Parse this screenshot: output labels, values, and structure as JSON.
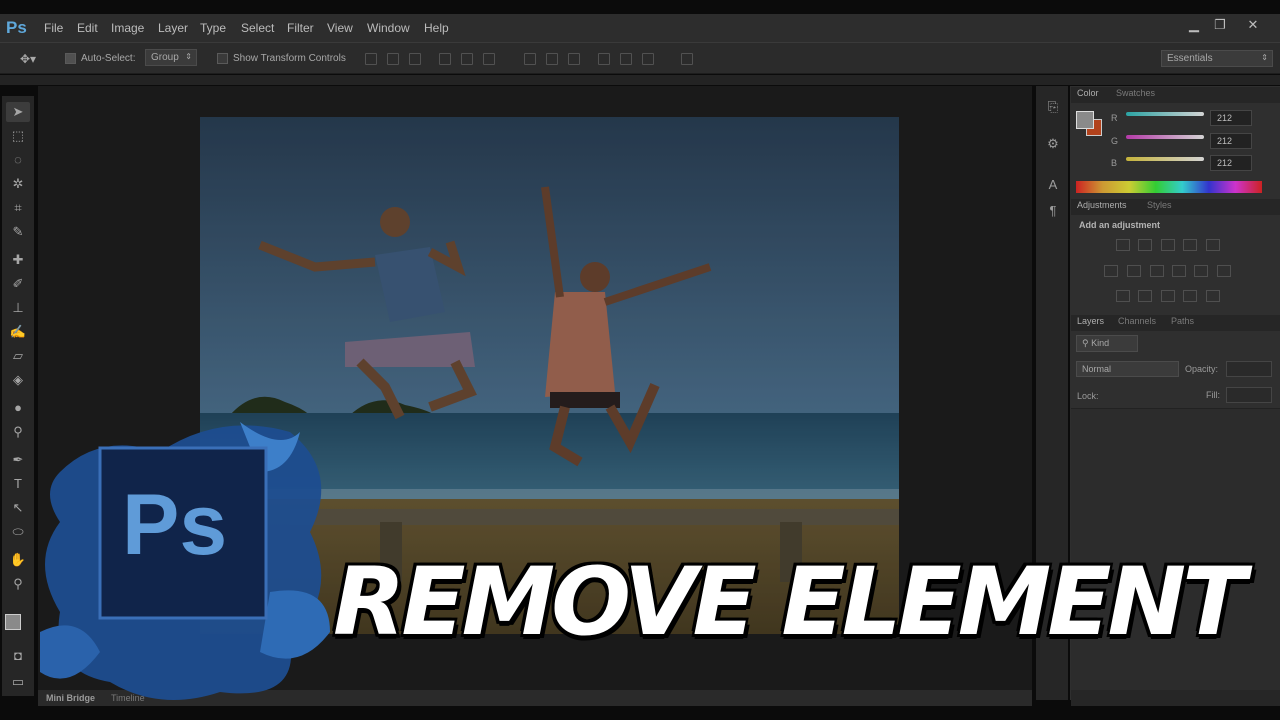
{
  "app": {
    "logo": "Ps",
    "menu": [
      "File",
      "Edit",
      "Image",
      "Layer",
      "Type",
      "Select",
      "Filter",
      "View",
      "Window",
      "Help"
    ],
    "window_controls": [
      "minimize",
      "restore",
      "close"
    ]
  },
  "options_bar": {
    "auto_select_label": "Auto-Select:",
    "auto_select_value": "Group",
    "show_transform_label": "Show Transform Controls",
    "workspace": "Essentials"
  },
  "color_panel": {
    "tabs": [
      "Color",
      "Swatches"
    ],
    "r_label": "R",
    "g_label": "G",
    "b_label": "B",
    "r": "212",
    "g": "212",
    "b": "212",
    "foreground": "#8a8a8a",
    "background": "#b2421c"
  },
  "adjustments_panel": {
    "tabs": [
      "Adjustments",
      "Styles"
    ],
    "heading": "Add an adjustment"
  },
  "layers_panel": {
    "tabs": [
      "Layers",
      "Channels",
      "Paths"
    ],
    "kind": "Kind",
    "blend_mode": "Normal",
    "opacity_label": "Opacity:",
    "lock_label": "Lock:",
    "fill_label": "Fill:"
  },
  "bottom_tabs": [
    "Mini Bridge",
    "Timeline"
  ],
  "overlay": {
    "title": "REMOVE ELEMENT",
    "badge_text": "Ps"
  }
}
